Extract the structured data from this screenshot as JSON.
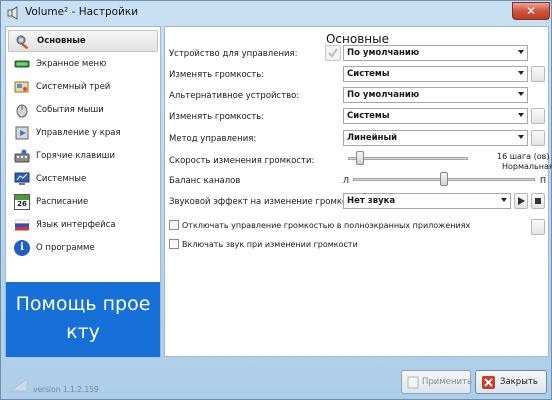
{
  "window": {
    "title": "Volume² - Настройки",
    "close_symbol": "✕"
  },
  "sidebar": {
    "items": [
      {
        "label": "Основные",
        "icon": "settings-tools-icon",
        "active": true
      },
      {
        "label": "Экранное меню",
        "icon": "osd-bar-icon"
      },
      {
        "label": "Системный трей",
        "icon": "tray-icon"
      },
      {
        "label": "События мыши",
        "icon": "mouse-icon"
      },
      {
        "label": "Управление у края",
        "icon": "edge-control-icon"
      },
      {
        "label": "Горячие клавиши",
        "icon": "hotkeys-icon"
      },
      {
        "label": "Системные",
        "icon": "system-icon"
      },
      {
        "label": "Расписание",
        "icon": "calendar-icon",
        "icon_text": "26"
      },
      {
        "label": "Язык интерфейса",
        "icon": "language-flag-icon"
      },
      {
        "label": "О программе",
        "icon": "info-icon",
        "icon_text": "i"
      }
    ],
    "help_banner": "Помощь прое кту"
  },
  "main": {
    "title": "Основные",
    "rows": {
      "device": {
        "label": "Устройство для управления:",
        "value": "По умолчанию"
      },
      "change_volume_1": {
        "label": "Изменять громкость:",
        "value": "Системы"
      },
      "alt_device": {
        "label": "Альтернативное устройство:",
        "value": "По умолчанию"
      },
      "change_volume_2": {
        "label": "Изменять громкость:",
        "value": "Системы"
      },
      "method": {
        "label": "Метод управления:",
        "value": "Линейный"
      },
      "speed": {
        "label": "Скорость изменения громкости:",
        "readout": "16 шага (ов)",
        "readout2": "Нормальная",
        "level": 0.1
      },
      "balance": {
        "label": "Баланс каналов",
        "left": "Л",
        "right": "П",
        "level": 0.5
      },
      "sound_effect": {
        "label": "Звуковой эффект на изменение громкости:",
        "value": "Нет звука"
      }
    },
    "checkboxes": [
      {
        "label": "Отключать управление громкостью в полноэкранных приложениях",
        "checked": false
      },
      {
        "label": "Включать звук при изменении громкости",
        "checked": false
      }
    ]
  },
  "footer": {
    "apply": "Применить",
    "close": "Закрыть",
    "version": "version 1.1.2.159"
  },
  "colors": {
    "banner": "#1770d8",
    "close_red": "#c13a22"
  }
}
